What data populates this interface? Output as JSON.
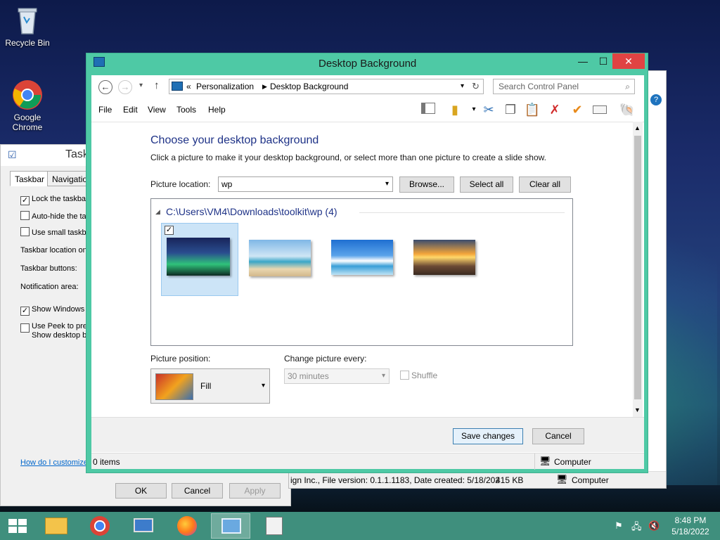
{
  "desktop": {
    "icons": [
      {
        "label": "Recycle Bin",
        "icon": "recycle-bin-icon"
      },
      {
        "label": "Google Chrome",
        "label_line1": "Google",
        "label_line2": "Chrome",
        "icon": "chrome-icon"
      }
    ]
  },
  "back_window": {
    "title": "Task",
    "tabs": [
      "Taskbar",
      "Navigation"
    ],
    "options": {
      "lock_taskbar": {
        "label": "Lock the taskbar",
        "checked": true
      },
      "auto_hide": {
        "label": "Auto-hide the ta",
        "checked": false
      },
      "small_buttons": {
        "label": "Use small taskba",
        "checked": false
      },
      "show_windows_store": {
        "label": "Show Windows S",
        "checked": true
      },
      "use_peek": {
        "label_line1": "Use Peek to pre",
        "label_line2": "Show desktop b",
        "checked": false
      }
    },
    "fields": {
      "location": "Taskbar location on",
      "buttons": "Taskbar buttons:",
      "notification": "Notification area:"
    },
    "link": "How do I customize",
    "buttons": {
      "ok": "OK",
      "cancel": "Cancel",
      "apply": "Apply"
    }
  },
  "explorer_behind": {
    "status_text": "ign Inc., File version: 0.1.1.1183, Date created: 5/18/202",
    "size": "415 KB",
    "computer": "Computer"
  },
  "window": {
    "title": "Desktop Background",
    "controls": {
      "minimize": "—",
      "maximize": "☐",
      "close": "✕"
    },
    "address": {
      "prefix": "«",
      "crumbs": [
        "Personalization",
        "Desktop Background"
      ]
    },
    "search_placeholder": "Search Control Panel",
    "menu": [
      "File",
      "Edit",
      "View",
      "Tools",
      "Help"
    ],
    "heading": "Choose your desktop background",
    "description": "Click a picture to make it your desktop background, or select more than one picture to create a slide show.",
    "picture_location_label": "Picture location:",
    "picture_location_value": "wp",
    "browse_label": "Browse...",
    "select_all_label": "Select all",
    "clear_all_label": "Clear all",
    "group_title": "C:\\Users\\VM4\\Downloads\\toolkit\\wp (4)",
    "wallpapers": [
      {
        "name": "aurora-wallpaper",
        "selected": true
      },
      {
        "name": "palm-beach-wallpaper",
        "selected": false
      },
      {
        "name": "blue-sky-island-wallpaper",
        "selected": false
      },
      {
        "name": "sunset-pier-wallpaper",
        "selected": false
      }
    ],
    "picture_position_label": "Picture position:",
    "picture_position_value": "Fill",
    "change_picture_label": "Change picture every:",
    "change_picture_value": "30 minutes",
    "shuffle_label": "Shuffle",
    "save_label": "Save changes",
    "cancel_label": "Cancel",
    "status_items": "0 items",
    "status_computer": "Computer"
  },
  "taskbar": {
    "apps": [
      "start-icon",
      "file-explorer-icon",
      "chrome-icon",
      "computer-icon",
      "firefox-icon",
      "control-panel-icon",
      "task-manager-icon"
    ],
    "clock_time": "8:48 PM",
    "clock_date": "5/18/2022"
  },
  "colors": {
    "window_frame": "#4ec9a5",
    "taskbar": "#3f8f7d",
    "heading_blue": "#1e3287",
    "close_red": "#e04343"
  }
}
